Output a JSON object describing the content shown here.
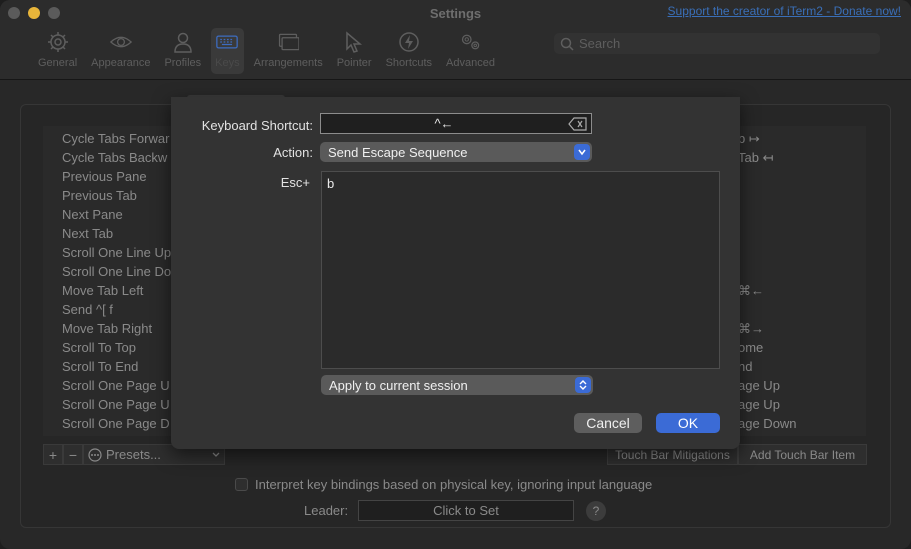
{
  "window": {
    "title": "Settings",
    "donate_link": "Support the creator of iTerm2 - Donate now!"
  },
  "toolbar": {
    "tabs": [
      {
        "label": "General",
        "icon": "gear-icon"
      },
      {
        "label": "Appearance",
        "icon": "eye-icon"
      },
      {
        "label": "Profiles",
        "icon": "person-icon"
      },
      {
        "label": "Keys",
        "icon": "keyboard-icon",
        "selected": true
      },
      {
        "label": "Arrangements",
        "icon": "windows-icon"
      },
      {
        "label": "Pointer",
        "icon": "pointer-icon"
      },
      {
        "label": "Shortcuts",
        "icon": "bolt-icon"
      },
      {
        "label": "Advanced",
        "icon": "gears-icon"
      }
    ],
    "search_placeholder": "Search"
  },
  "key_bindings": {
    "actions": [
      "Cycle Tabs Forwar",
      "Cycle Tabs Backw",
      "Previous Pane",
      "Previous Tab",
      "Next Pane",
      "Next Tab",
      "Scroll One Line Up",
      "Scroll One Line Do",
      "Move Tab Left",
      "Send ^[ f",
      "Move Tab Right",
      "Scroll To Top",
      "Scroll To End",
      "Scroll One Page U",
      "Scroll One Page U",
      "Scroll One Page D"
    ],
    "right_column": [
      {
        "row": 0,
        "text": "b ↦"
      },
      {
        "row": 1,
        "text": "Tab ↤"
      },
      {
        "row": 8,
        "text": "⌘←"
      },
      {
        "row": 10,
        "text": "⌘→"
      },
      {
        "row": 11,
        "text": "ome"
      },
      {
        "row": 12,
        "text": "nd"
      },
      {
        "row": 13,
        "text": "age Up"
      },
      {
        "row": 14,
        "text": "age Up"
      },
      {
        "row": 15,
        "text": "age Down"
      }
    ],
    "add_label": "+",
    "remove_label": "−",
    "presets_label": "Presets...",
    "touch_bar_mitigations": "Touch Bar Mitigations",
    "add_touch_bar_item": "Add Touch Bar Item"
  },
  "interpret_checkbox": {
    "label": "Interpret key bindings based on physical key, ignoring input language",
    "checked": false
  },
  "leader": {
    "label": "Leader:",
    "button": "Click to Set",
    "help": "?"
  },
  "sheet": {
    "shortcut_label": "Keyboard Shortcut:",
    "shortcut_value": "^←",
    "action_label": "Action:",
    "action_value": "Send Escape Sequence",
    "esc_label": "Esc+",
    "esc_value": "b",
    "apply_value": "Apply to current session",
    "cancel_label": "Cancel",
    "ok_label": "OK"
  },
  "colors": {
    "accent": "#3b6bd6",
    "background": "#282828"
  }
}
